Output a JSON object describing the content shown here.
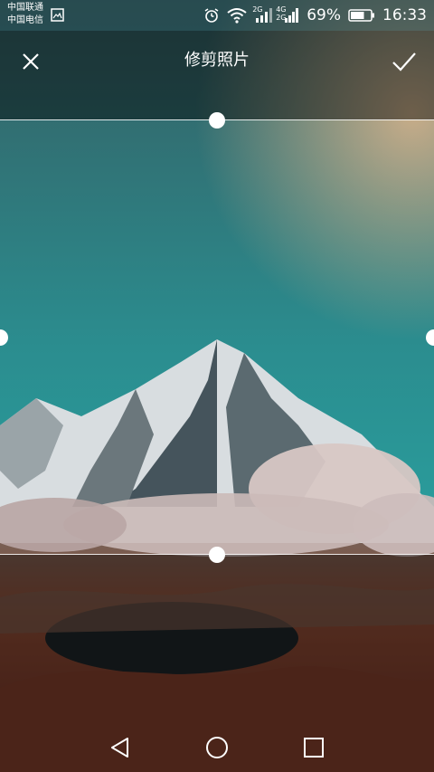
{
  "status_bar": {
    "carrier_1": "中国联通",
    "carrier_2": "中国电信",
    "network_label_top": "2G",
    "network_label_4g": "4G",
    "network_label_2g": "2G",
    "battery_percent": "69%",
    "time": "16:33",
    "battery_level": 0.69,
    "icons": [
      "image-notification-icon",
      "alarm-icon",
      "wifi-icon",
      "signal-icon",
      "signal-icon",
      "battery-icon"
    ]
  },
  "header": {
    "title": "修剪照片",
    "close_icon": "close-icon",
    "confirm_icon": "checkmark-icon"
  },
  "crop": {
    "handles": [
      "top",
      "bottom",
      "left",
      "right"
    ]
  },
  "navigation": {
    "icons": [
      "back-icon",
      "home-icon",
      "recents-icon"
    ]
  },
  "colors": {
    "sky_top": "#3f6f74",
    "sky_bottom": "#2fb3b0",
    "ground": "#7a3a2a",
    "overlay": "rgba(0,0,0,0.45)"
  }
}
